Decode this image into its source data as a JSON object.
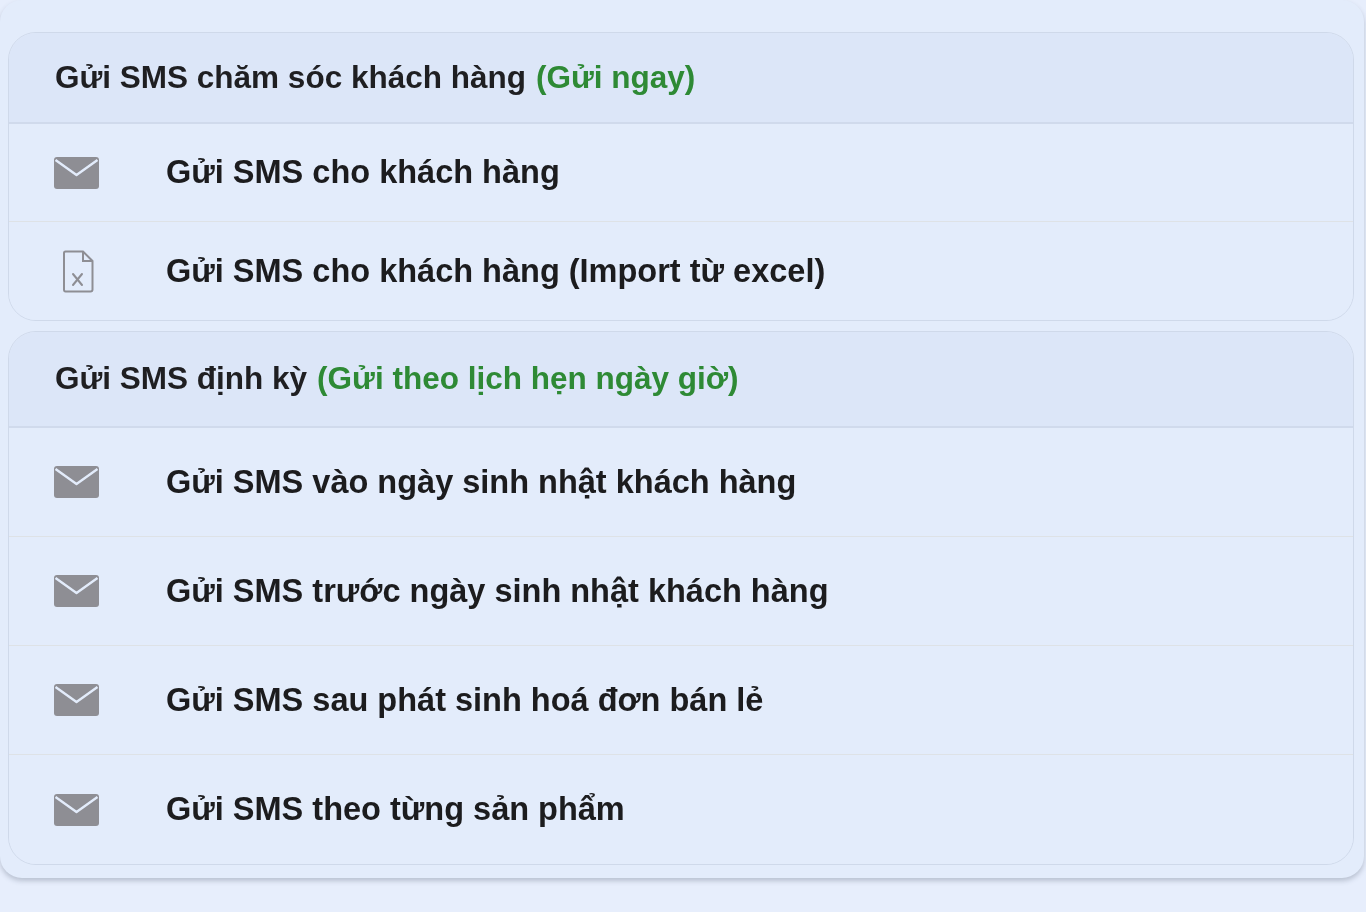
{
  "sections": [
    {
      "title": "Gửi SMS chăm sóc khách hàng",
      "note": "(Gửi ngay)",
      "items": [
        {
          "kind": "mail",
          "label": "Gửi SMS cho khách hàng"
        },
        {
          "kind": "excel",
          "label": "Gửi SMS cho khách hàng (Import từ excel)"
        }
      ]
    },
    {
      "title": "Gửi SMS định kỳ",
      "note": "(Gửi theo lịch hẹn ngày giờ)",
      "items": [
        {
          "kind": "mail",
          "label": "Gửi SMS vào ngày sinh nhật khách hàng"
        },
        {
          "kind": "mail",
          "label": "Gửi SMS trước ngày sinh nhật khách hàng"
        },
        {
          "kind": "mail",
          "label": "Gửi SMS sau phát sinh hoá đơn bán lẻ"
        },
        {
          "kind": "mail",
          "label": "Gửi SMS theo từng sản phẩm"
        }
      ]
    }
  ]
}
